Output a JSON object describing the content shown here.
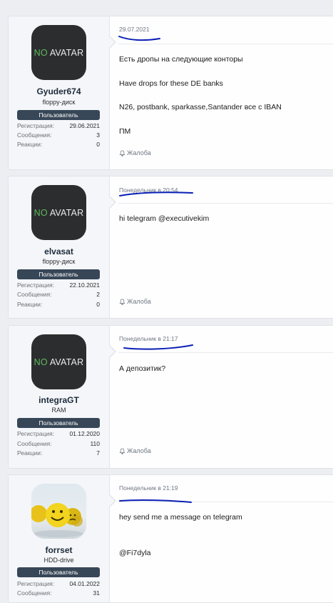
{
  "posts": [
    {
      "avatar": {
        "no": "NO",
        "rest": "AVATAR"
      },
      "username": "Gyuder674",
      "usertitle": "floppy-диск",
      "badge": "Пользователь",
      "stats": [
        {
          "k": "Регистрация:",
          "v": "29.06.2021"
        },
        {
          "k": "Сообщения:",
          "v": "3"
        },
        {
          "k": "Реакции:",
          "v": "0"
        }
      ],
      "date": "29.07.2021",
      "message": [
        "Есть дропы на следующие конторы",
        "Have drops for these DE banks",
        "N26, postbank, sparkasse,Santander все с IBAN",
        "ПМ"
      ],
      "report": "Жалоба"
    },
    {
      "avatar": {
        "no": "NO",
        "rest": "AVATAR"
      },
      "username": "elvasat",
      "usertitle": "floppy-диск",
      "badge": "Пользователь",
      "stats": [
        {
          "k": "Регистрация:",
          "v": "22.10.2021"
        },
        {
          "k": "Сообщения:",
          "v": "2"
        },
        {
          "k": "Реакции:",
          "v": "0"
        }
      ],
      "date": "Понедельник в 20:54",
      "message": [
        "hi telegram @executivekim"
      ],
      "report": "Жалоба"
    },
    {
      "avatar": {
        "no": "NO",
        "rest": "AVATAR"
      },
      "username": "integraGT",
      "usertitle": "RAM",
      "badge": "Пользователь",
      "stats": [
        {
          "k": "Регистрация:",
          "v": "01.12.2020"
        },
        {
          "k": "Сообщения:",
          "v": "110"
        },
        {
          "k": "Реакции:",
          "v": "7"
        }
      ],
      "date": "Понедельник в 21:17",
      "message": [
        "А депозитик?"
      ],
      "report": "Жалоба"
    },
    {
      "username": "forrset",
      "usertitle": "HDD-drive",
      "badge": "Пользователь",
      "stats": [
        {
          "k": "Регистрация:",
          "v": "04.01.2022"
        },
        {
          "k": "Сообщения:",
          "v": "31"
        }
      ],
      "date": "Понедельник в 21:19",
      "message": [
        "hey send me a message on telegram",
        "@Fi7dyla"
      ]
    }
  ],
  "colors": {
    "page_bg": "#eceef2",
    "badge_bg": "#384757",
    "avatar_bg": "#2b2d2f",
    "avatar_no": "#5fbb5d",
    "scribble": "#0a1fb5"
  },
  "icons": {
    "report": "bell-icon",
    "avatar_photo": "smiley-balls-image"
  }
}
